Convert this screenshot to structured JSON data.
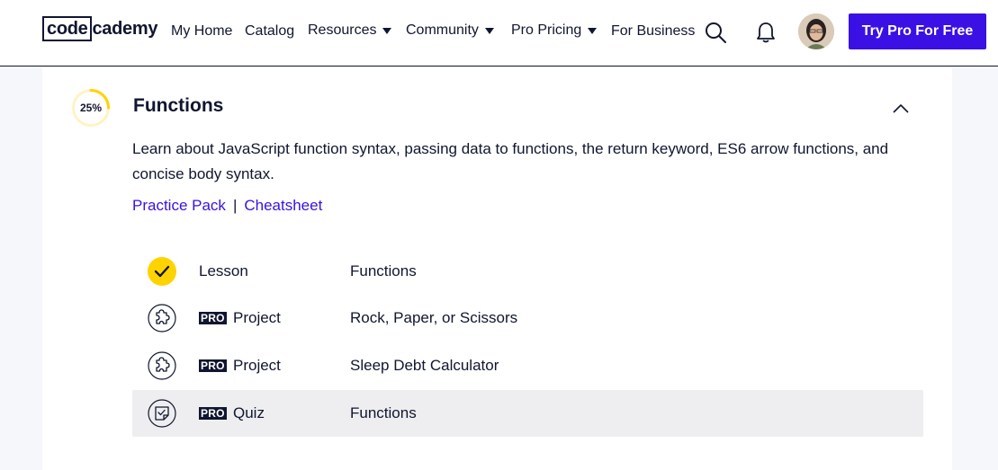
{
  "nav": {
    "logo": {
      "part1": "code",
      "part2": "cademy"
    },
    "items": [
      {
        "label": "My Home",
        "dropdown": false
      },
      {
        "label": "Catalog",
        "dropdown": false
      },
      {
        "label": "Resources",
        "dropdown": true
      },
      {
        "label": "Community",
        "dropdown": true
      },
      {
        "label": "Pro Pricing",
        "dropdown": true
      },
      {
        "label": "For Business",
        "dropdown": false
      }
    ],
    "icons": [
      "search-icon",
      "bell-icon"
    ],
    "cta_label": "Try Pro For Free"
  },
  "module": {
    "progress_label": "25%",
    "progress_fraction": 0.25,
    "title": "Functions",
    "description": "Learn about JavaScript function syntax, passing data to functions, the return keyword, ES6 arrow functions, and concise body syntax.",
    "links": {
      "practice_pack": "Practice Pack",
      "separator": "|",
      "cheatsheet": "Cheatsheet"
    },
    "items": [
      {
        "icon": "check-icon",
        "pro": "",
        "type": "Lesson",
        "name": "Functions",
        "completed": true
      },
      {
        "icon": "puzzle-icon",
        "pro": "PRO",
        "type": "Project",
        "name": "Rock, Paper, or Scissors",
        "completed": false
      },
      {
        "icon": "puzzle-icon",
        "pro": "PRO",
        "type": "Project",
        "name": "Sleep Debt Calculator",
        "completed": false
      },
      {
        "icon": "quiz-icon",
        "pro": "PRO",
        "type": "Quiz",
        "name": "Functions",
        "completed": false
      }
    ]
  },
  "colors": {
    "brand_blue": "#3a10e5",
    "navy": "#10162f",
    "progress_yellow": "#ffd300",
    "progress_track": "#fff3c4",
    "row_highlight": "#eeeef0"
  }
}
